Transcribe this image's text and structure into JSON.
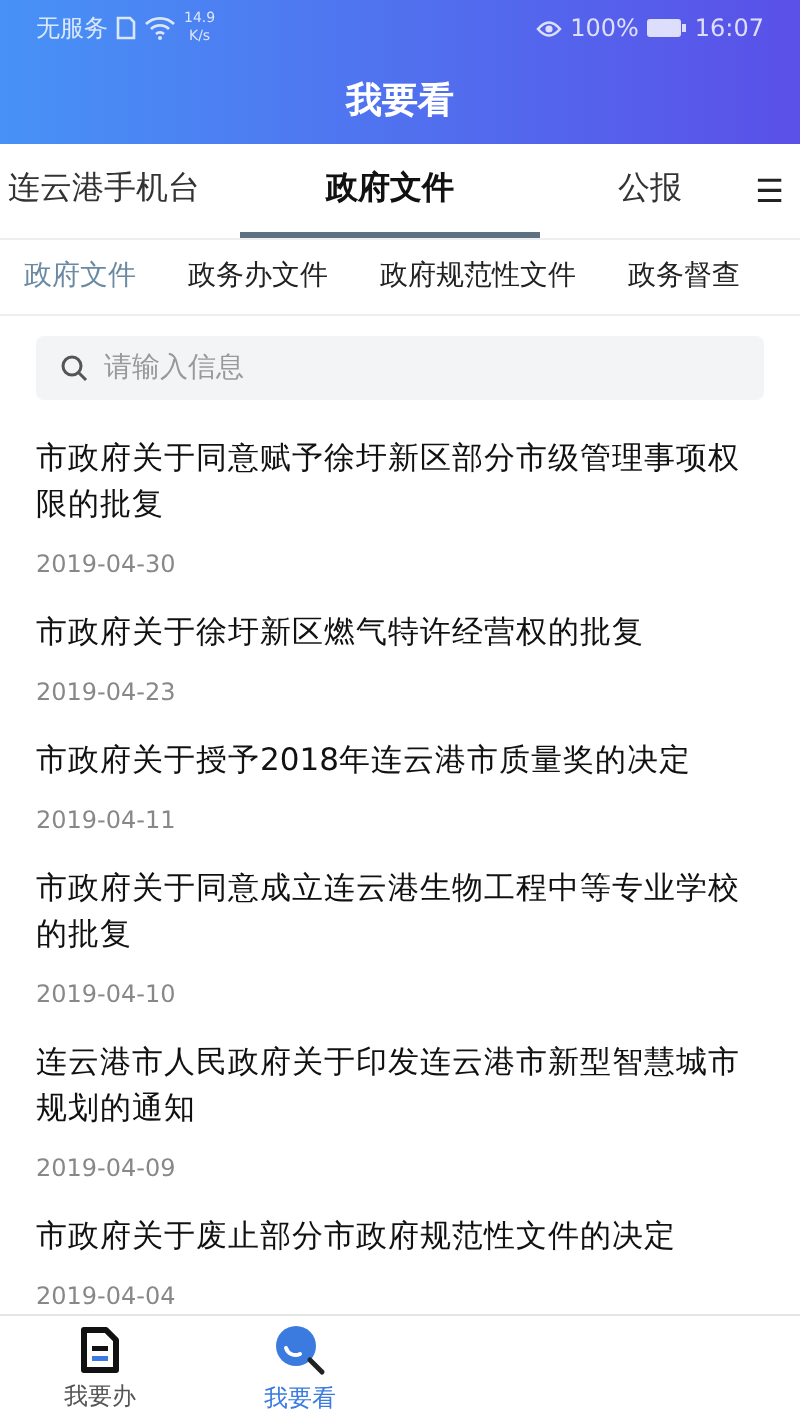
{
  "status_bar": {
    "carrier": "无服务",
    "speed_value": "14.9",
    "speed_unit": "K/s",
    "battery": "100%",
    "time": "16:07"
  },
  "header": {
    "title": "我要看"
  },
  "channel_tabs": [
    {
      "label": "连云港手机台",
      "selected": false
    },
    {
      "label": "政府文件",
      "selected": true
    },
    {
      "label": "公报",
      "selected": false
    }
  ],
  "menu_glyph": "☰",
  "sub_tabs": [
    {
      "label": "政府文件",
      "selected": true
    },
    {
      "label": "政务办文件",
      "selected": false
    },
    {
      "label": "政府规范性文件",
      "selected": false
    },
    {
      "label": "政务督查",
      "selected": false
    }
  ],
  "search": {
    "placeholder": "请输入信息"
  },
  "articles": [
    {
      "title": "市政府关于同意赋予徐圩新区部分市级管理事项权限的批复",
      "date": "2019-04-30"
    },
    {
      "title": "市政府关于徐圩新区燃气特许经营权的批复",
      "date": "2019-04-23"
    },
    {
      "title": "市政府关于授予2018年连云港市质量奖的决定",
      "date": "2019-04-11"
    },
    {
      "title": "市政府关于同意成立连云港生物工程中等专业学校的批复",
      "date": "2019-04-10"
    },
    {
      "title": "连云港市人民政府关于印发连云港市新型智慧城市规划的通知",
      "date": "2019-04-09"
    },
    {
      "title": "市政府关于废止部分市政府规范性文件的决定",
      "date": "2019-04-04"
    }
  ],
  "bottom_nav": [
    {
      "label": "我要办",
      "kind": "doc",
      "selected": false
    },
    {
      "label": "我要看",
      "kind": "search",
      "selected": true
    }
  ]
}
